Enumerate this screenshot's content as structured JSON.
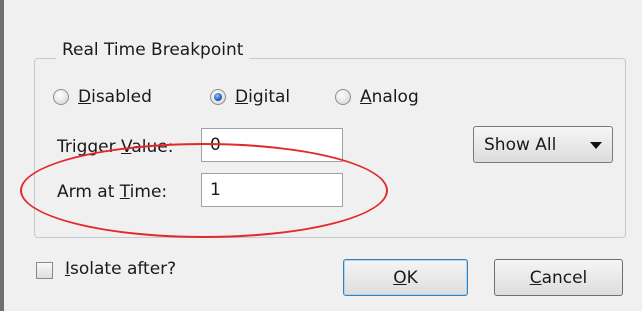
{
  "group": {
    "title": "Real Time Breakpoint"
  },
  "modes": [
    {
      "label_key": "D",
      "label_rest": "isabled",
      "checked": false
    },
    {
      "label_key": "D",
      "label_rest": "igital",
      "checked": true
    },
    {
      "label_key": "A",
      "label_rest": "nalog",
      "checked": false
    }
  ],
  "trigger": {
    "label_pre": "Trigger ",
    "label_key": "V",
    "label_post": "alue:",
    "value": "0"
  },
  "arm": {
    "label_pre": "Arm at ",
    "label_key": "T",
    "label_post": "ime:",
    "value": "1"
  },
  "show_dropdown": {
    "selected": "Show All"
  },
  "isolate": {
    "label_key": "I",
    "label_rest": "solate after?",
    "checked": false
  },
  "buttons": {
    "ok": {
      "label_key": "O",
      "label_rest": "K"
    },
    "cancel": {
      "label_key": "C",
      "label_rest": "ancel"
    }
  },
  "annotation": {
    "color": "#e32a2a"
  }
}
